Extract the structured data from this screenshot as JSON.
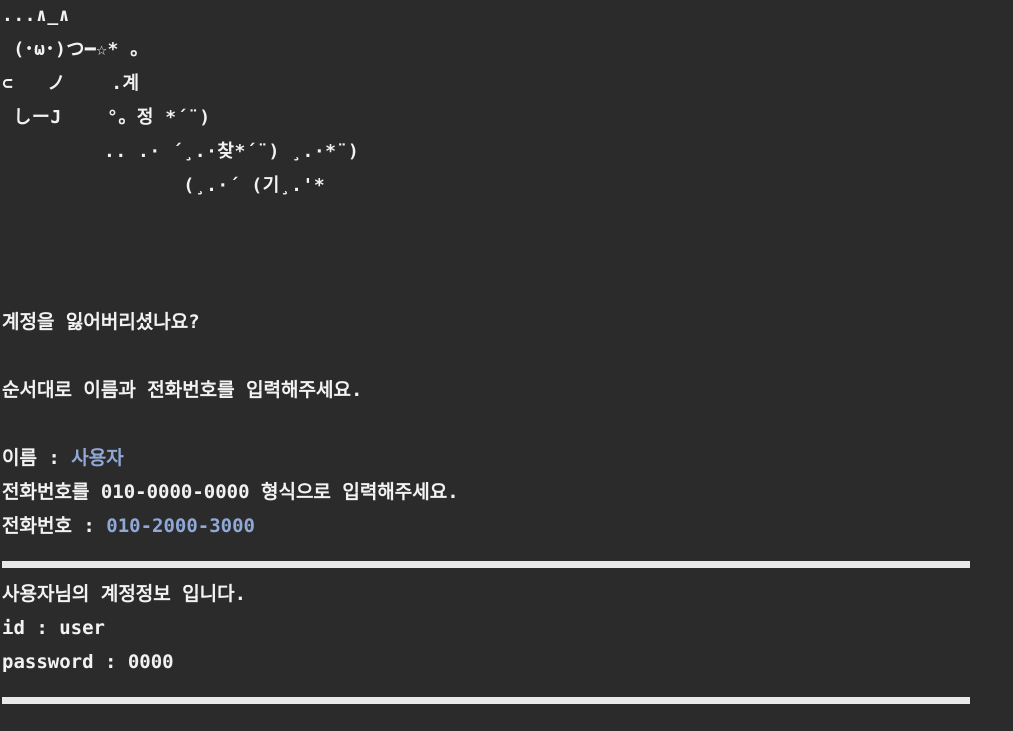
{
  "ascii_art": [
    "...∧_∧",
    " (･ω･)つ━☆* 。",
    "⊂   ノ    .계",
    " しーJ    °。정 *´¨)",
    "         .. .· ´¸.·찾*´¨) ¸.·*¨)",
    "                (¸.·´ (기¸.'*"
  ],
  "prompts": {
    "lost_account": "계정을 잃어버리셨나요?",
    "instruction": "순서대로 이름과 전화번호를 입력해주세요.",
    "name_label": "이름 : ",
    "name_value": "사용자",
    "phone_format_hint": "전화번호를 010-0000-0000 형식으로 입력해주세요.",
    "phone_label": "전화번호 : ",
    "phone_value": "010-2000-3000"
  },
  "result": {
    "title": "사용자님의 계정정보 입니다.",
    "id_line": "id : user",
    "password_line": "password : 0000"
  }
}
